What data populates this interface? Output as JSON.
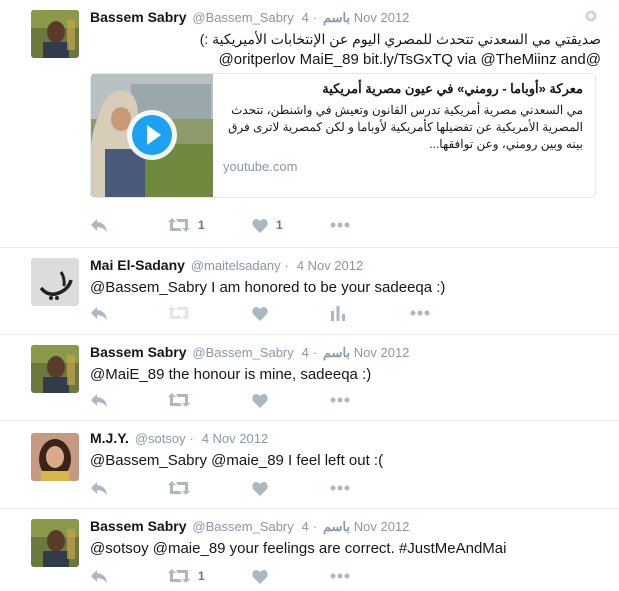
{
  "tweets": [
    {
      "name": "Bassem Sabry",
      "handle": "@Bassem_Sabry",
      "arabic_name": "باسم",
      "date": "4 Nov 2012",
      "text_rtl": "صديقتي مي السعدني تتحدث للمصري اليوم عن الإنتخابات الأميريكية :)",
      "text_rtl2": "@oritperlov MaiE_89 bit.ly/TsGxTQ via @TheMiinz and@",
      "card": {
        "title": "معركة «أوباما - رومني» في عيون مصرية أمريكية",
        "desc": "مي السعدني مصرية أمريكية تدرس القانون وتعيش في واشنطن، تتحدث المصرية الأمريكية عن تفضيلها كأمريكية لأوباما و لكن كمصرية لاترى فرق بينه وبين رومني، وعن توافقها...",
        "domain": "youtube.com"
      },
      "retweets": "1",
      "likes": "1"
    },
    {
      "name": "Mai El-Sadany",
      "handle": "@maitelsadany",
      "date": "4 Nov 2012",
      "text": "@Bassem_Sabry I am honored to be your sadeeqa :)"
    },
    {
      "name": "Bassem Sabry",
      "handle": "@Bassem_Sabry",
      "arabic_name": "باسم",
      "date": "4 Nov 2012",
      "text": "@MaiE_89 the honour is mine, sadeeqa :)"
    },
    {
      "name": "M.J.Y.",
      "handle": "@sotsoy",
      "date": "4 Nov 2012",
      "text": "@Bassem_Sabry @maie_89 I feel left out :("
    },
    {
      "name": "Bassem Sabry",
      "handle": "@Bassem_Sabry",
      "arabic_name": "باسم",
      "date": "4 Nov 2012",
      "text": "@sotsoy @maie_89 your feelings are correct. #JustMeAndMai",
      "retweets": "1"
    }
  ],
  "colors": {
    "icon_gray": "#aab8c2",
    "meta_gray": "#8899a6",
    "play_blue": "#1da1f2"
  },
  "icons": [
    "reply-icon",
    "retweet-icon",
    "like-icon",
    "analytics-icon",
    "more-icon",
    "globe-icon",
    "play-icon"
  ]
}
